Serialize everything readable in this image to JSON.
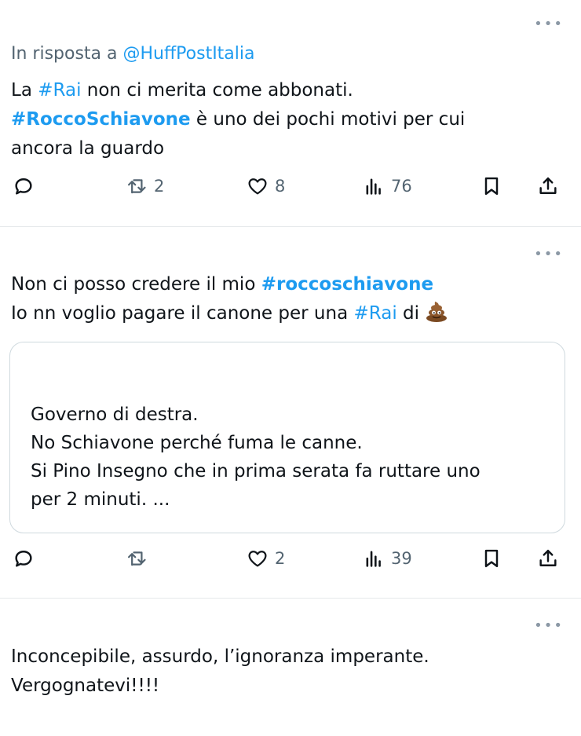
{
  "tweets": [
    {
      "reply_prefix": "In risposta a ",
      "reply_handle": "@HuffPostItalia",
      "line1_pre": "La ",
      "line1_hashtag": "#Rai",
      "line1_post": " non ci merita come abbonati.",
      "line2_hashtag": "#RoccoSchiavone",
      "line2_post": " è uno dei pochi motivi per cui",
      "line3": "ancora la guardo",
      "retweets": "2",
      "likes": "8",
      "views": "76"
    },
    {
      "line1_pre": "Non ci posso credere il mio ",
      "line1_hashtag": "#roccoschiavone",
      "line2_pre": "Io nn voglio pagare il canone per una ",
      "line2_hashtag": "#Rai",
      "line2_post": " di ",
      "emoji": "pile-of-poo-emoji",
      "quote": {
        "line1": "Governo di destra.",
        "line2": "No Schiavone perché fuma le canne.",
        "line3": "Si Pino Insegno che in prima serata fa ruttare uno",
        "line4": "per 2 minuti. ..."
      },
      "likes": "2",
      "views": "39"
    },
    {
      "line1": "Inconcepibile, assurdo, l’ignoranza imperante.",
      "line2": "Vergognatevi!!!!"
    }
  ],
  "icons": {
    "more": "more-icon",
    "reply": "reply-icon",
    "retweet": "retweet-icon",
    "like": "heart-icon",
    "views": "views-icon",
    "bookmark": "bookmark-icon",
    "share": "share-icon"
  },
  "colors": {
    "link": "#1d9bf0",
    "muted": "#536471",
    "text": "#0f1419",
    "divider": "#e6e9eb"
  }
}
